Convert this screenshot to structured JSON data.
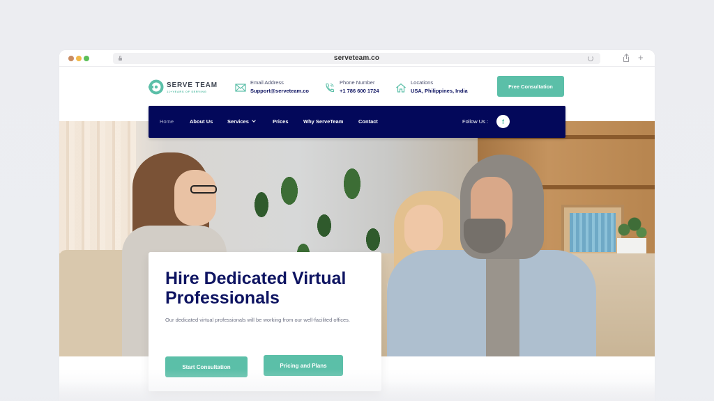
{
  "browser": {
    "url": "serveteam.co",
    "icons": [
      "lock-icon",
      "reload-icon",
      "share-icon",
      "plus-icon"
    ]
  },
  "header": {
    "logo": {
      "title": "SERVE TEAM",
      "tagline": "11+YEARS OF SERVING"
    },
    "email": {
      "label": "Email Address",
      "value": "Support@serveteam.co",
      "icon": "mail-icon"
    },
    "phone": {
      "label": "Phone Number",
      "value": "+1 786 600 1724",
      "icon": "phone-icon"
    },
    "location": {
      "label": "Locations",
      "value": "USA, Philippines, India",
      "icon": "home-icon"
    },
    "cta_label": "Free Consultation"
  },
  "nav": {
    "items": [
      {
        "label": "Home",
        "active": true
      },
      {
        "label": "About Us"
      },
      {
        "label": "Services",
        "has_dropdown": true
      },
      {
        "label": "Prices"
      },
      {
        "label": "Why ServeTeam"
      },
      {
        "label": "Contact"
      }
    ],
    "follow_label": "Follow Us :",
    "social_icon": "f"
  },
  "hero": {
    "title": "Hire Dedicated Virtual Professionals",
    "description": "Our dedicated virtual professionals will be working from our well-facilited offices.",
    "primary_button": "Start Consultation",
    "secondary_button": "Pricing and Plans"
  },
  "colors": {
    "brand_teal": "#5bbfa8",
    "navy": "#03085a",
    "heading_navy": "#0d1361"
  }
}
